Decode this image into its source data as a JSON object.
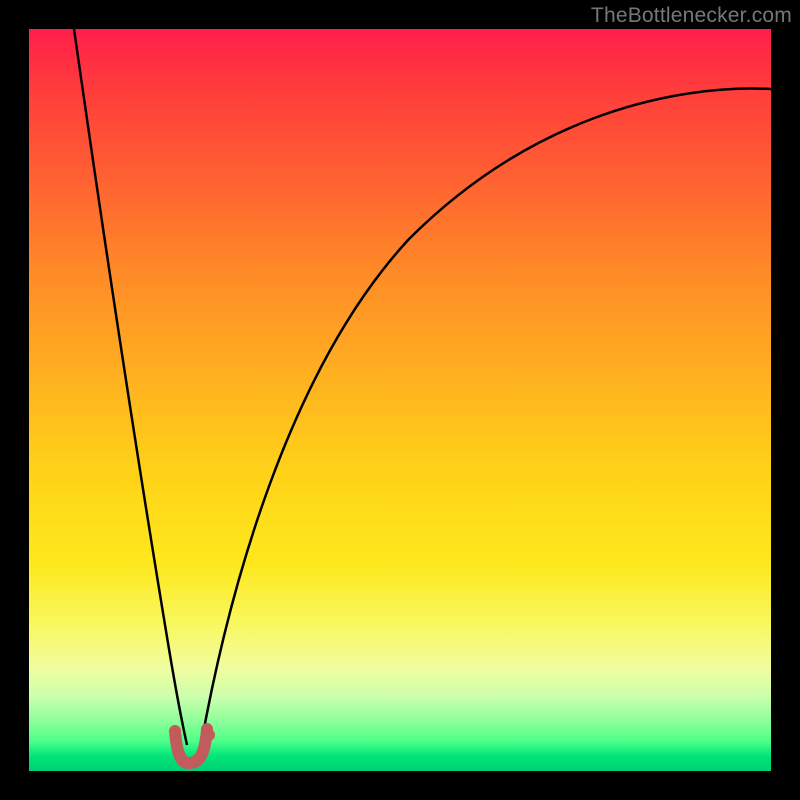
{
  "watermark": "TheBottlenecker.com",
  "chart_data": {
    "type": "line",
    "title": "",
    "xlabel": "",
    "ylabel": "",
    "xlim": [
      0,
      100
    ],
    "ylim": [
      0,
      100
    ],
    "grid": false,
    "legend": false,
    "notch_x": 21,
    "series": [
      {
        "name": "left-branch",
        "x": [
          6,
          8,
          10,
          12,
          14,
          16,
          18,
          19,
          20
        ],
        "y": [
          100,
          88,
          76,
          63,
          49,
          34,
          18,
          10,
          4
        ]
      },
      {
        "name": "right-branch",
        "x": [
          22,
          24,
          27,
          31,
          36,
          42,
          50,
          60,
          72,
          86,
          100
        ],
        "y": [
          4,
          14,
          28,
          42,
          54,
          64,
          73,
          80,
          85,
          89,
          91
        ]
      },
      {
        "name": "notch-marker",
        "x": [
          19,
          20,
          21,
          22,
          23
        ],
        "y": [
          6,
          2,
          1,
          2,
          6
        ]
      }
    ],
    "background_gradient": {
      "top": "#ff1e4b",
      "mid": "#ffd318",
      "bottom": "#00cf74"
    },
    "marker_color": "#c25b5b"
  }
}
